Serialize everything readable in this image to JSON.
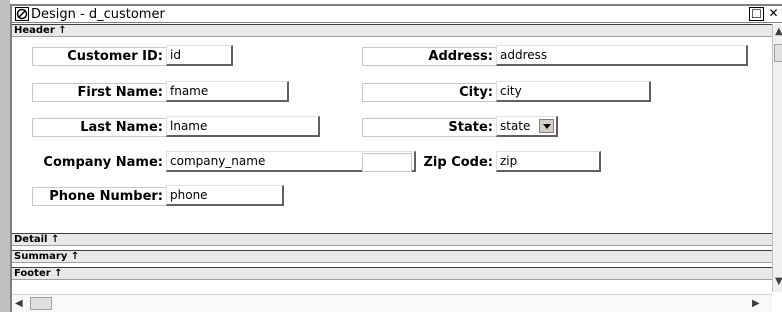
{
  "window": {
    "title": "Design - d_customer",
    "maximize_glyph": "☐",
    "close_glyph": "✕"
  },
  "bands": {
    "header": "Header ↑",
    "detail": "Detail ↑",
    "summary": "Summary ↑",
    "footer": "Footer ↑"
  },
  "fields": {
    "customer_id": {
      "label": "Customer ID:",
      "value": "id"
    },
    "first_name": {
      "label": "First Name:",
      "value": "fname"
    },
    "last_name": {
      "label": "Last Name:",
      "value": "lname"
    },
    "company_name": {
      "label": "Company Name:",
      "value": "company_name"
    },
    "phone_number": {
      "label": "Phone Number:",
      "value": "phone"
    },
    "address": {
      "label": "Address:",
      "value": "address"
    },
    "city": {
      "label": "City:",
      "value": "city"
    },
    "state": {
      "label": "State:",
      "value": "state"
    },
    "zip_code": {
      "label": "Zip Code:",
      "value": "zip"
    }
  },
  "icons": {
    "window": "datawindow-icon",
    "scroll_up": "chevron-up-icon",
    "scroll_down": "chevron-down-icon",
    "scroll_left": "chevron-left-icon",
    "scroll_right": "chevron-right-icon"
  }
}
